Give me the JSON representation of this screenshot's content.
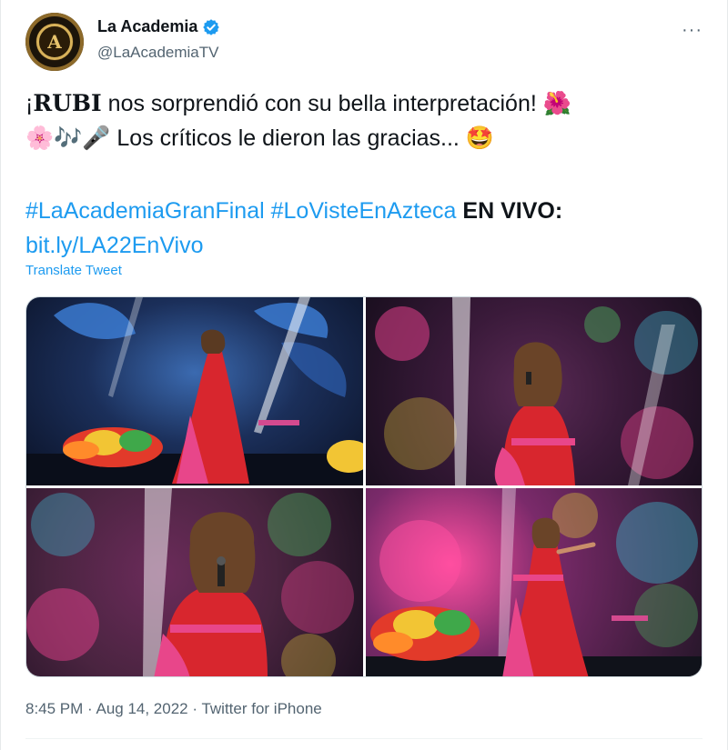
{
  "author": {
    "display_name": "La Academia",
    "handle": "@LaAcademiaTV",
    "avatar_letter": "A",
    "verified": true
  },
  "more_label": "···",
  "tweet": {
    "line1_prefix": "¡",
    "line1_bold": "RUBI",
    "line1_rest": " nos sorprendió con su bella interpretación! 🌺",
    "line2": "🌸🎶🎤 Los críticos le dieron las gracias... 🤩",
    "hashtag1": "#LaAcademiaGranFinal",
    "hashtag2": "#LoVisteEnAzteca",
    "live_label": "EN VIVO:",
    "url": "bit.ly/LA22EnVivo",
    "translate_label": "Translate Tweet"
  },
  "media": [
    {
      "alt": "Rubi performing on stage in red gown, wide shot"
    },
    {
      "alt": "Rubi singing, medium shot with kaleidoscope background"
    },
    {
      "alt": "Rubi singing, close-up"
    },
    {
      "alt": "Rubi on stage with flower decoration"
    }
  ],
  "footer": {
    "time": "8:45 PM",
    "date": "Aug 14, 2022",
    "source": "Twitter for iPhone",
    "separator": " · "
  },
  "colors": {
    "link": "#1d9bf0",
    "secondary_text": "#536471",
    "primary_text": "#0f1419",
    "gown_red": "#d8262e",
    "gown_pink": "#e8468a"
  }
}
